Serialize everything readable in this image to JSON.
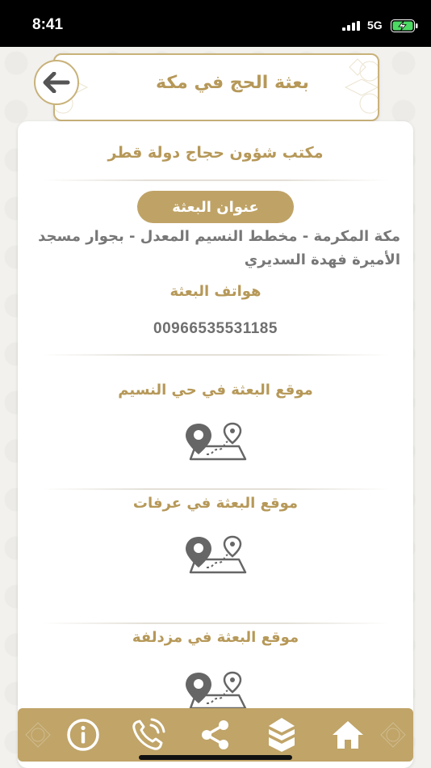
{
  "status_bar": {
    "time": "8:41",
    "network": "5G",
    "icons": [
      "signal-icon",
      "battery-charging-icon"
    ]
  },
  "header": {
    "title": "بعثة الحج في مكة",
    "back_icon": "arrow-left-icon"
  },
  "office": {
    "name": "مكتب شؤون حجاج دولة قطر",
    "address_label": "عنوان البعثة",
    "address": "مكة المكرمة - مخطط النسيم المعدل - بجوار مسجد الأميرة فهدة السديري",
    "phones_label": "هواتف البعثة",
    "phone": "00966535531185"
  },
  "locations": [
    {
      "title": "موقع البعثة في حي النسيم",
      "icon": "map-location-icon"
    },
    {
      "title": "موقع البعثة في عرفات",
      "icon": "map-location-icon"
    },
    {
      "title": "موقع البعثة في مزدلفة",
      "icon": "map-location-icon"
    }
  ],
  "bottom_nav": {
    "items": [
      "info-icon",
      "phone-icon",
      "share-icon",
      "kaaba-icon",
      "home-icon"
    ]
  },
  "colors": {
    "gold": "#b69858",
    "gold_bar": "#c0a468",
    "text_gray": "#777777"
  }
}
